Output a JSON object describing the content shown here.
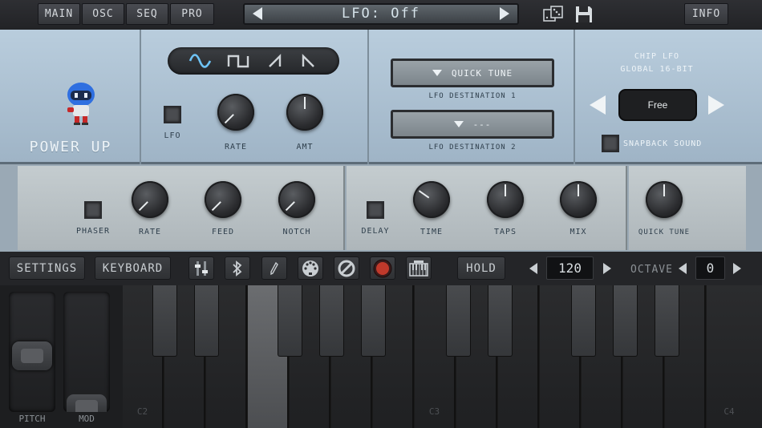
{
  "topbar": {
    "tabs": [
      "MAIN",
      "OSC",
      "SEQ",
      "PRO"
    ],
    "preset_name": "LFO: Off",
    "info_label": "INFO",
    "icons": [
      "dice-icon",
      "save-icon"
    ]
  },
  "power_up": {
    "title": "POWER UP"
  },
  "lfo": {
    "waveforms": [
      "sine",
      "square",
      "saw-up",
      "saw-down"
    ],
    "lfo_label": "LFO",
    "rate_label": "RATE",
    "amt_label": "AMT"
  },
  "destinations": {
    "dest1_value": "QUICK TUNE",
    "dest1_label": "LFO DESTINATION 1",
    "dest2_value": "---",
    "dest2_label": "LFO DESTINATION 2"
  },
  "chip_lfo": {
    "title_line1": "CHIP LFO",
    "title_line2": "GLOBAL 16-BIT",
    "mode_value": "Free",
    "snapback_label": "SNAPBACK SOUND"
  },
  "effects": {
    "phaser_label": "PHASER",
    "rate_label": "RATE",
    "feed_label": "FEED",
    "notch_label": "NOTCH",
    "delay_label": "DELAY",
    "time_label": "TIME",
    "taps_label": "TAPS",
    "mix_label": "MIX",
    "quick_tune_label": "QUICK TUNE"
  },
  "bottombar": {
    "settings_label": "SETTINGS",
    "keyboard_label": "KEYBOARD",
    "hold_label": "HOLD",
    "tempo_value": "120",
    "octave_label": "OCTAVE",
    "octave_value": "0"
  },
  "wheels": {
    "pitch_label": "PITCH",
    "mod_label": "MOD"
  },
  "keyboard": {
    "octave_labels": [
      "C2",
      "C3",
      "C4"
    ]
  },
  "colors": {
    "panel_blue": "#b9cddd",
    "panel_grey": "#c4cccf",
    "record_red": "#c0392b"
  }
}
